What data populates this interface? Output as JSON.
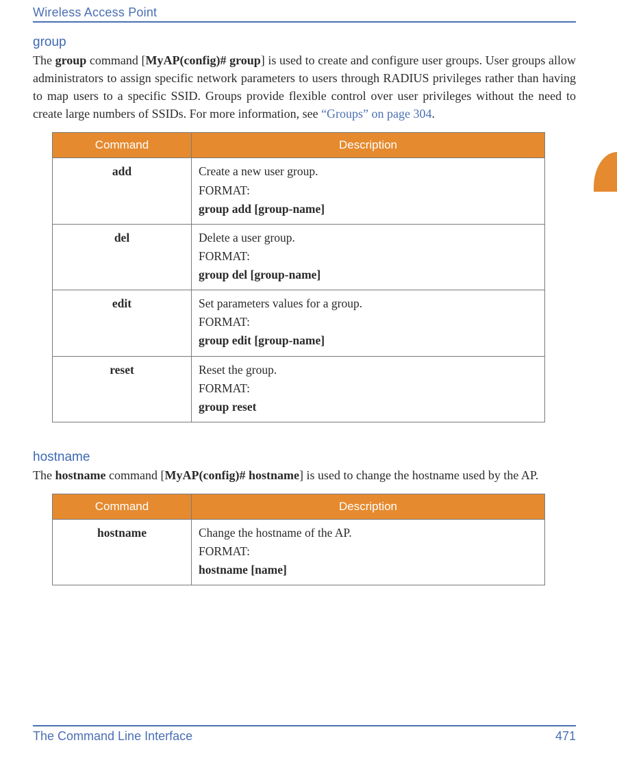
{
  "runningHead": "Wireless Access Point",
  "thumbTab": {
    "color": "#e58a2f"
  },
  "sections": {
    "group": {
      "title": "group",
      "para": {
        "pre": "The ",
        "cmd": "group",
        "mid1": " command [",
        "prompt": "MyAP(config)# group",
        "mid2": "] is used to create and configure user groups. User groups allow administrators to assign specific network parameters to users through RADIUS privileges rather than having to map users to a specific SSID. Groups provide flexible control over user privileges without the need to create large numbers of SSIDs. For more information, see ",
        "link": "“Groups” on page 304",
        "end": "."
      },
      "table": {
        "headers": {
          "cmd": "Command",
          "desc": "Description"
        },
        "rows": [
          {
            "cmd": "add",
            "line1": "Create a new user group.",
            "line2": "FORMAT:",
            "line3": "group add [group-name]"
          },
          {
            "cmd": "del",
            "line1": "Delete a user group.",
            "line2": "FORMAT:",
            "line3": "group del [group-name]"
          },
          {
            "cmd": "edit",
            "line1": "Set parameters values for a group.",
            "line2": "FORMAT:",
            "line3": "group edit [group-name]"
          },
          {
            "cmd": "reset",
            "line1": "Reset the group.",
            "line2": "FORMAT:",
            "line3": "group reset"
          }
        ]
      }
    },
    "hostname": {
      "title": "hostname",
      "para": {
        "pre": "The ",
        "cmd": "hostname",
        "mid1": " command [",
        "prompt": "MyAP(config)# hostname",
        "mid2": "] is used to change the hostname used by the AP."
      },
      "table": {
        "headers": {
          "cmd": "Command",
          "desc": "Description"
        },
        "rows": [
          {
            "cmd": "hostname",
            "line1": "Change the hostname of the AP.",
            "line2": "FORMAT:",
            "line3": "hostname [name]"
          }
        ]
      }
    }
  },
  "footer": {
    "left": "The Command Line Interface",
    "right": "471"
  }
}
